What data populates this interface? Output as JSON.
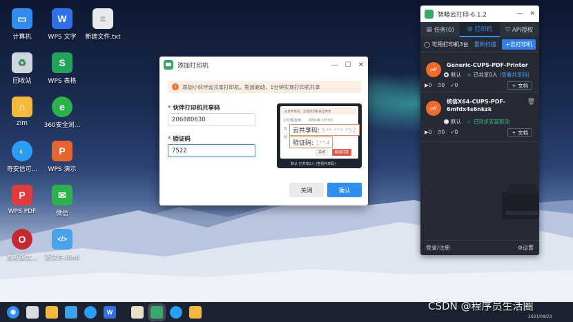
{
  "desktop": {
    "icons": [
      {
        "label": "计算机",
        "icon": "computer-icon",
        "color": "#2f8ef0"
      },
      {
        "label": "WPS 文字",
        "icon": "wps-writer-icon",
        "color": "#2f6fe8"
      },
      {
        "label": "新建文件.txt",
        "icon": "text-file-icon",
        "color": "#e9e9e9"
      },
      {
        "label": "回收站",
        "icon": "recycle-bin-icon",
        "color": "#cfd6de"
      },
      {
        "label": "WPS 表格",
        "icon": "wps-spreadsheet-icon",
        "color": "#22a35a"
      },
      {
        "label": "zim",
        "icon": "folder-icon",
        "color": "#f6b93b"
      },
      {
        "label": "360安全浏...",
        "icon": "360-browser-icon",
        "color": "#2bb24c"
      },
      {
        "label": "奇安信可...",
        "icon": "qianxin-browser-icon",
        "color": "#2a9df4"
      },
      {
        "label": "WPS 演示",
        "icon": "wps-presentation-icon",
        "color": "#e8632d"
      },
      {
        "label": "WPS PDF",
        "icon": "wps-pdf-icon",
        "color": "#e03a3a"
      },
      {
        "label": "微信",
        "icon": "wechat-icon",
        "color": "#2bb24c"
      },
      {
        "label": "友虹版式...",
        "icon": "ofd-reader-icon",
        "color": "#c7282d"
      },
      {
        "label": "新文件.html",
        "icon": "html-file-icon",
        "color": "#4aa3e8"
      }
    ]
  },
  "dialog": {
    "title": "添加打印机",
    "notice": "添加小伙伴云共享打印机，免装驱动，1分钟实现打印机共享",
    "share_code_label": "伙伴打印机共享码",
    "share_code_value": "206880630",
    "verify_code_label": "验证码",
    "verify_code_value": "7522",
    "cancel_label": "关闭",
    "confirm_label": "确认",
    "preview": {
      "notice": "分享共享码，实现打印机安全共享",
      "printer_name_label": "打印机名称:",
      "printer_name_value": "EPSON L3153",
      "cloud_label": "云",
      "verify_short": "验",
      "share_code_label": "云共享码:",
      "share_code_blurred": "5** *** *52",
      "verify_label": "验证码:",
      "verify_blurred": "1**4",
      "close_label": "关闭",
      "cancel_share_label": "取消共享",
      "footer": "默认  已共享2人 (查看共享码)"
    }
  },
  "panel": {
    "title": "智睦云打印-6.1.2",
    "tabs": [
      {
        "label": "任务(0)",
        "icon": "list-icon"
      },
      {
        "label": "打印机",
        "icon": "globe-icon"
      },
      {
        "label": "API授权",
        "icon": "shield-icon"
      }
    ],
    "available": "可用打印机3台",
    "rescan": "重新扫描",
    "add_cloud": "+云打印机",
    "printers": [
      {
        "name": "Generic-CUPS-PDF-Printer",
        "default_label": "默认",
        "status": "已共享0人",
        "status_link": "(查看共享码)",
        "counts": [
          "0",
          "0",
          "0"
        ],
        "doc_label": "+ 文档"
      },
      {
        "name": "统信X64-CUPS-PDF-6mfdx4s6nkzk",
        "default_label": "默认",
        "status": "已同步安装驱动",
        "counts": [
          "0",
          "0",
          "0"
        ],
        "doc_label": "+ 文档"
      }
    ],
    "login": "登录/注册",
    "settings": "设置"
  },
  "watermark": "CSDN @程序员生活圈",
  "clock_date": "2021/09/23",
  "colors": {
    "accent": "#2f80ed",
    "warn": "#f07a2c",
    "panel_bg": "#252a34"
  }
}
